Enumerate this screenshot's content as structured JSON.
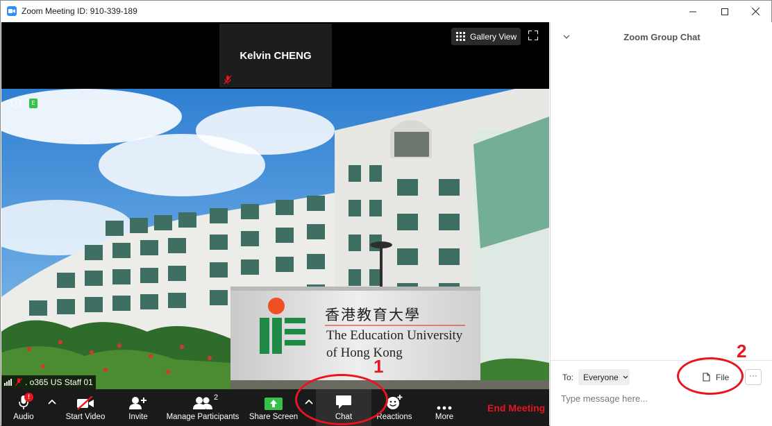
{
  "window": {
    "title": "Zoom Meeting ID: 910-339-189",
    "controls": [
      "minimize",
      "maximize",
      "close"
    ]
  },
  "video": {
    "active_speaker_name": "Kelvin CHENG",
    "view_button_label": "Gallery View",
    "participant_label": ". o365 US Staff 01",
    "sign_text_chinese": "香港教育大學",
    "sign_text_line1": "The Education University",
    "sign_text_line2": "of Hong Kong"
  },
  "toolbar": {
    "audio_label": "Audio",
    "video_label": "Start Video",
    "invite_label": "Invite",
    "participants_label": "Manage Participants",
    "participants_count": "2",
    "share_label": "Share Screen",
    "chat_label": "Chat",
    "reactions_label": "Reactions",
    "more_label": "More",
    "end_label": "End Meeting",
    "audio_badge": "!"
  },
  "chat": {
    "title": "Zoom Group Chat",
    "to_label": "To:",
    "recipient": "Everyone",
    "file_label": "File",
    "more_label": "···",
    "input_placeholder": "Type message here..."
  },
  "annotations": {
    "marker_1": "1",
    "marker_2": "2"
  },
  "colors": {
    "accent": "#2d8cff",
    "annotation": "#e8141e",
    "end_meeting": "#e8141e",
    "toolbar_bg": "#1a1a1a",
    "share_green": "#35c24a"
  }
}
